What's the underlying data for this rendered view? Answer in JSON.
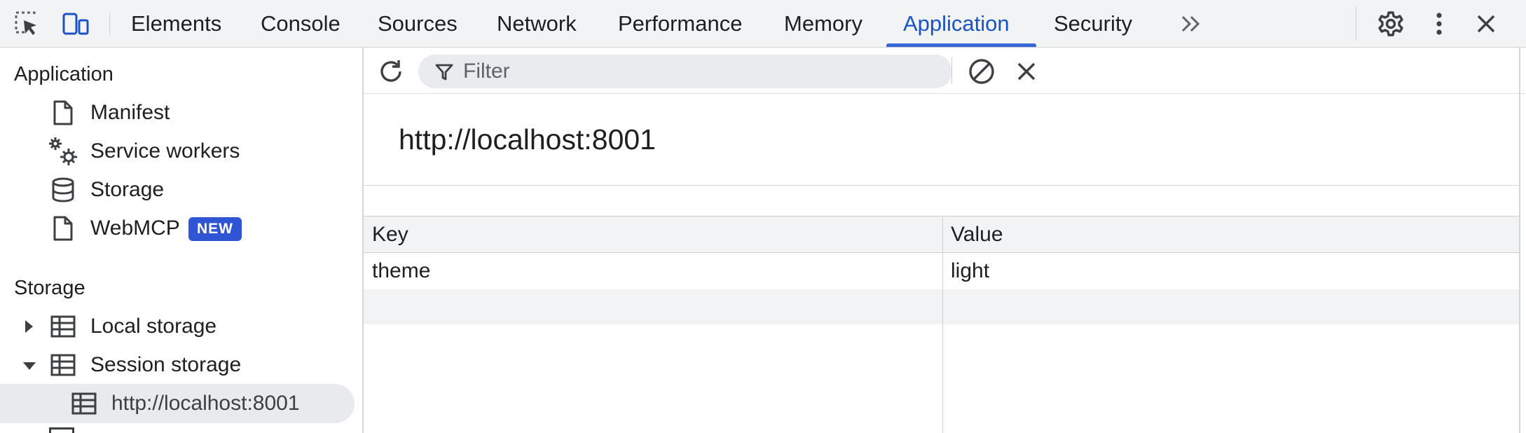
{
  "toolbar": {
    "tabs": [
      {
        "label": "Elements"
      },
      {
        "label": "Console"
      },
      {
        "label": "Sources"
      },
      {
        "label": "Network"
      },
      {
        "label": "Performance"
      },
      {
        "label": "Memory"
      },
      {
        "label": "Application",
        "active": true
      },
      {
        "label": "Security"
      }
    ],
    "icons": [
      "inspect-element-icon",
      "device-toolbar-icon",
      "more-tabs-icon",
      "settings-gear-icon",
      "more-options-icon",
      "close-icon"
    ],
    "active_color": "#1a53c8"
  },
  "sidebar": {
    "application_section": {
      "title": "Application",
      "items": [
        {
          "label": "Manifest",
          "icon": "document-icon"
        },
        {
          "label": "Service workers",
          "icon": "gears-icon"
        },
        {
          "label": "Storage",
          "icon": "database-icon"
        },
        {
          "label": "WebMCP",
          "icon": "document-icon",
          "badge": "NEW"
        }
      ]
    },
    "storage_section": {
      "title": "Storage",
      "items": [
        {
          "label": "Local storage",
          "icon": "table-icon",
          "expanded": false
        },
        {
          "label": "Session storage",
          "icon": "table-icon",
          "expanded": true
        },
        {
          "label": "http://localhost:8001",
          "icon": "table-icon",
          "selected": true
        }
      ]
    },
    "badge_color": "#2f55d4"
  },
  "main": {
    "filter": {
      "placeholder": "Filter",
      "value": ""
    },
    "origin": "http://localhost:8001",
    "table": {
      "columns": [
        "Key",
        "Value"
      ],
      "rows": [
        {
          "key": "theme",
          "value": "light"
        }
      ]
    }
  }
}
